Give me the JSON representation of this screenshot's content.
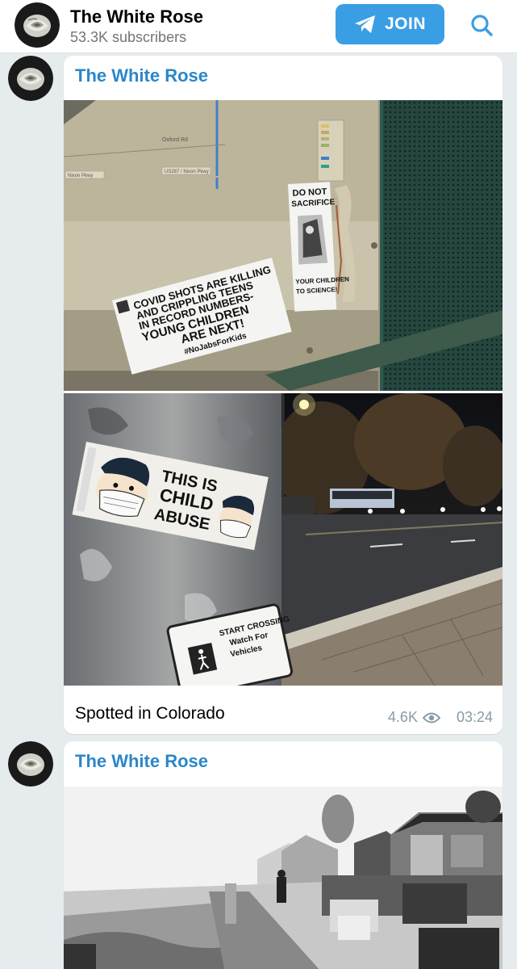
{
  "header": {
    "channel_name": "The White Rose",
    "subscribers": "53.3K subscribers",
    "join_label": "JOIN"
  },
  "messages": [
    {
      "author": "The White Rose",
      "photo1": {
        "map_labels": [
          "Oxford Rd",
          "US287 / Nixon Pkwy",
          "Nixon Pkwy"
        ],
        "sticker_covid": [
          "COVID SHOTS ARE KILLING",
          "AND CRIPPLING TEENS",
          "IN RECORD NUMBERS-",
          "YOUNG CHILDREN",
          "ARE NEXT!",
          "#NoJabsForKids"
        ],
        "sticker_sacrifice_top": [
          "DO NOT",
          "SACRIFICE"
        ],
        "sticker_sacrifice_bottom": [
          "YOUR CHILDREN",
          "TO SCIENCE!"
        ]
      },
      "photo2": {
        "sticker_abuse": [
          "THIS IS",
          "CHILD",
          "ABUSE"
        ],
        "sign_text": [
          "START CROSSING",
          "Watch For",
          "Vehicles"
        ]
      },
      "caption": "Spotted in Colorado",
      "views": "4.6K",
      "time": "03:24"
    },
    {
      "author": "The White Rose"
    }
  ]
}
